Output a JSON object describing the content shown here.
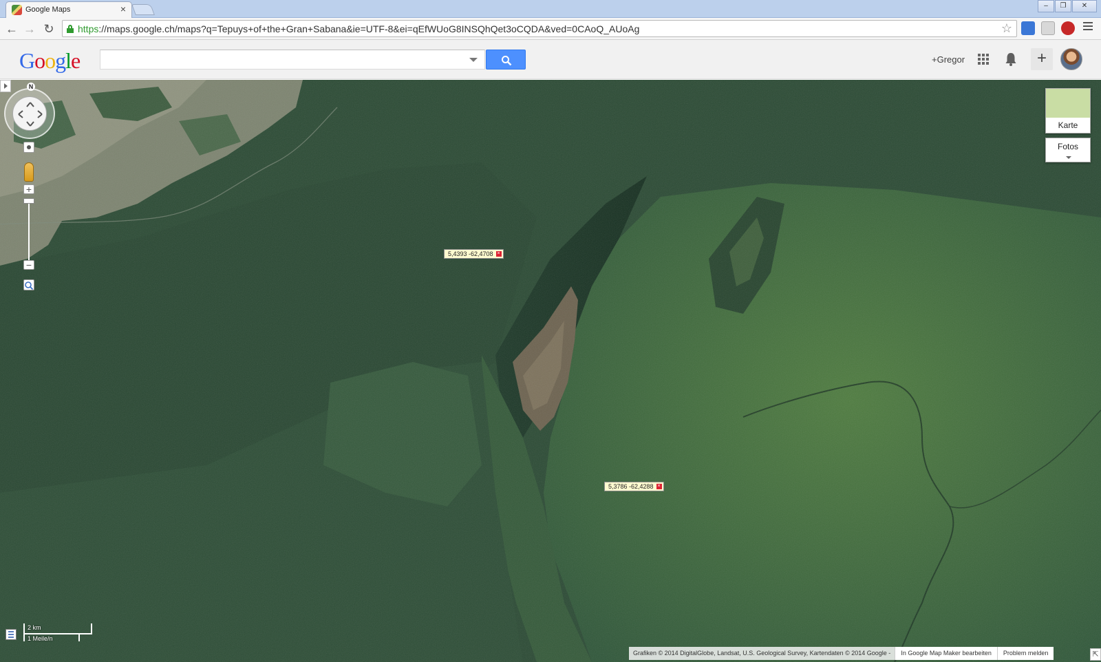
{
  "browser": {
    "tab_title": "Google Maps",
    "tab_close": "×",
    "url_scheme": "https",
    "url_rest": "://maps.google.ch/maps?q=Tepuys+of+the+Gran+Sabana&ie=UTF-8&ei=qEfWUoG8INSQhQet3oCQDA&ved=0CAoQ_AUoAg",
    "window_controls": [
      "‒",
      "❐",
      "✕"
    ],
    "nav": {
      "back": "←",
      "forward": "→",
      "reload": "↻"
    },
    "star": "☆"
  },
  "header": {
    "logo_letters": [
      "G",
      "o",
      "o",
      "g",
      "l",
      "e"
    ],
    "logo_colors": [
      "#3369e8",
      "#d50f25",
      "#eeb211",
      "#3369e8",
      "#009925",
      "#d50f25"
    ],
    "search_value": "",
    "user_link": "+Gregor",
    "plus_label": "+"
  },
  "map": {
    "compass_letter": "N",
    "zoom_in": "+",
    "zoom_out": "−",
    "markers": [
      {
        "label": "5,4393 -62,4708",
        "close": "×"
      },
      {
        "label": "5,3786 -62,4288",
        "close": "×"
      }
    ],
    "layer_switch": {
      "map_label": "Karte",
      "photos_label": "Fotos"
    },
    "scale": {
      "metric": "2 km",
      "imperial": "1 Meile/n"
    },
    "footer": {
      "credits": "Grafiken © 2014 DigitalGlobe, Landsat, U.S. Geological Survey, Kartendaten © 2014 Google -",
      "edit_link": "In Google Map Maker bearbeiten",
      "report_link": "Problem melden"
    }
  },
  "colors": {
    "accent_blue": "#4d90fe",
    "secure_green": "#2f9a2f",
    "forest_dark": "#2b4a34",
    "plateau_light": "#4e7a3e",
    "rock_brown": "#6e6550",
    "savanna": "#8d9180"
  }
}
